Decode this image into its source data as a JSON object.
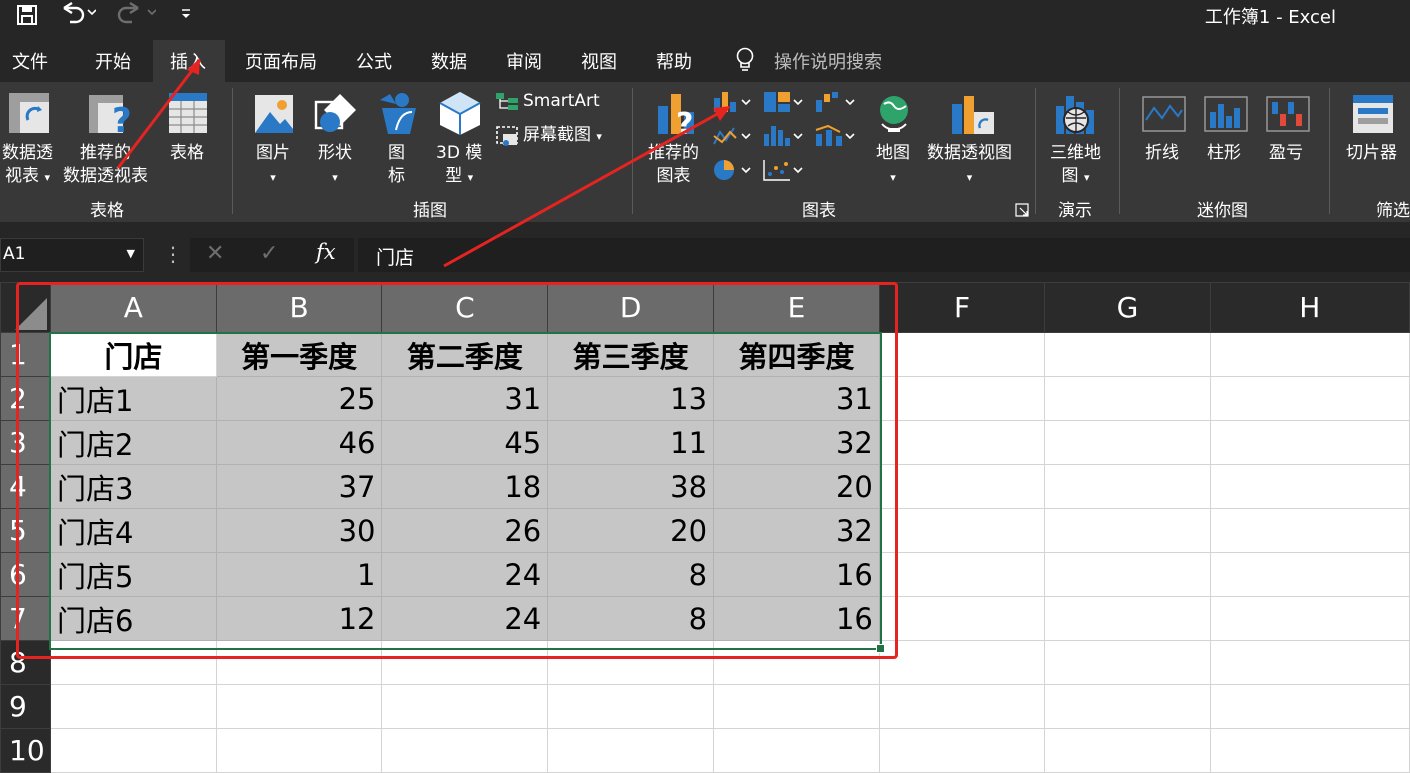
{
  "window": {
    "title": "工作簿1  -  Excel"
  },
  "quick_access": {
    "save": "save-icon",
    "undo": "undo-icon",
    "redo": "redo-icon",
    "customize": "customize-icon"
  },
  "tabs": [
    "文件",
    "开始",
    "插入",
    "页面布局",
    "公式",
    "数据",
    "审阅",
    "视图",
    "帮助"
  ],
  "active_tab": "插入",
  "search": {
    "placeholder": "操作说明搜索"
  },
  "ribbon": {
    "tables": {
      "group": "表格",
      "pivot": [
        "数据透",
        "视表"
      ],
      "recommended_pivot": [
        "推荐的",
        "数据透视表"
      ],
      "table": "表格"
    },
    "illustrations": {
      "group": "插图",
      "pictures": "图片",
      "shapes": "形状",
      "icons": [
        "图",
        "标"
      ],
      "models": [
        "3D 模",
        "型"
      ],
      "smartart": "SmartArt",
      "screenshot": "屏幕截图"
    },
    "charts": {
      "group": "图表",
      "recommended": [
        "推荐的",
        "图表"
      ],
      "maps": "地图",
      "pivot_chart": "数据透视图"
    },
    "tours": {
      "group": "演示",
      "map3d": [
        "三维地",
        "图"
      ]
    },
    "sparklines": {
      "group": "迷你图",
      "line": "折线",
      "column": "柱形",
      "winloss": "盈亏"
    },
    "filters": {
      "group": "筛选",
      "slicer": "切片器"
    }
  },
  "formula_bar": {
    "name_box": "A1",
    "formula": "门店"
  },
  "sheet": {
    "columns": [
      "A",
      "B",
      "C",
      "D",
      "E",
      "F",
      "G",
      "H"
    ],
    "rows": [
      "1",
      "2",
      "3",
      "4",
      "5",
      "6",
      "7",
      "8",
      "9",
      "10"
    ],
    "header": [
      "门店",
      "第一季度",
      "第二季度",
      "第三季度",
      "第四季度"
    ],
    "data": [
      [
        "门店1",
        "25",
        "31",
        "13",
        "31"
      ],
      [
        "门店2",
        "46",
        "45",
        "11",
        "32"
      ],
      [
        "门店3",
        "37",
        "18",
        "38",
        "20"
      ],
      [
        "门店4",
        "30",
        "26",
        "20",
        "32"
      ],
      [
        "门店5",
        "1",
        "24",
        "8",
        "16"
      ],
      [
        "门店6",
        "12",
        "24",
        "8",
        "16"
      ]
    ],
    "selection_color": "#217346",
    "annotation_color": "#e52421"
  }
}
